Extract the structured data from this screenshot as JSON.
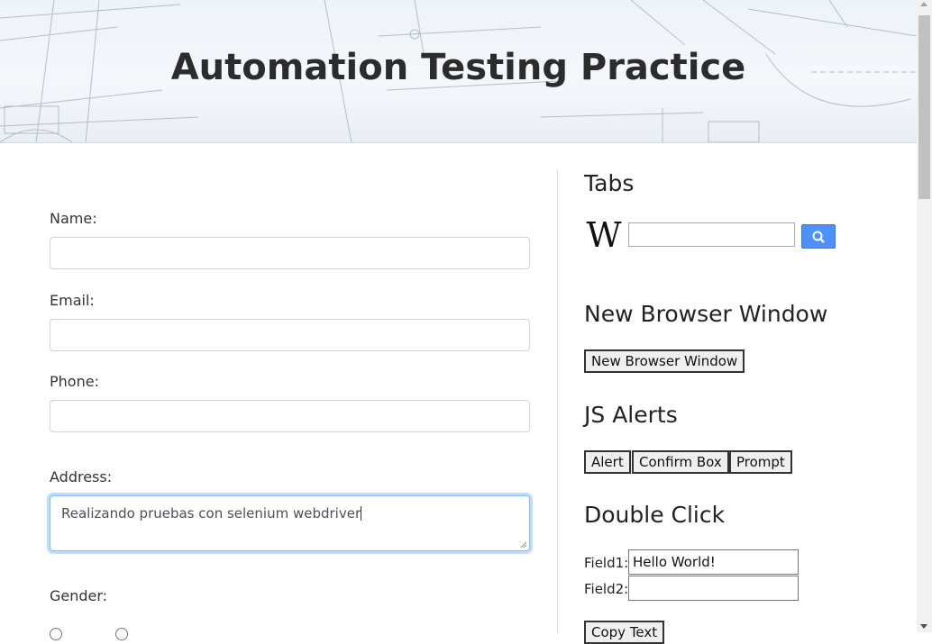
{
  "header": {
    "title": "Automation Testing Practice"
  },
  "form": {
    "name_label": "Name:",
    "email_label": "Email:",
    "phone_label": "Phone:",
    "address_label": "Address:",
    "address_value": "Realizando pruebas con selenium webdriver",
    "gender_label": "Gender:"
  },
  "sidebar": {
    "tabs_title": "Tabs",
    "wiki_logo_letter": "W",
    "new_window_title": "New Browser Window",
    "new_window_button": "New Browser Window",
    "js_alerts_title": "JS Alerts",
    "alert_button": "Alert",
    "confirm_button": "Confirm Box",
    "prompt_button": "Prompt",
    "double_click_title": "Double Click",
    "field1_label": "Field1:",
    "field1_value": "Hello World!",
    "field2_label": "Field2:",
    "field2_value": "",
    "copy_button": "Copy Text"
  },
  "colors": {
    "search_button": "#4d90fe",
    "focus_border": "#80bdff"
  },
  "icons": {
    "search": "magnifier-icon",
    "wikipedia": "wikipedia-logo-icon",
    "resize": "resize-handle-icon"
  }
}
